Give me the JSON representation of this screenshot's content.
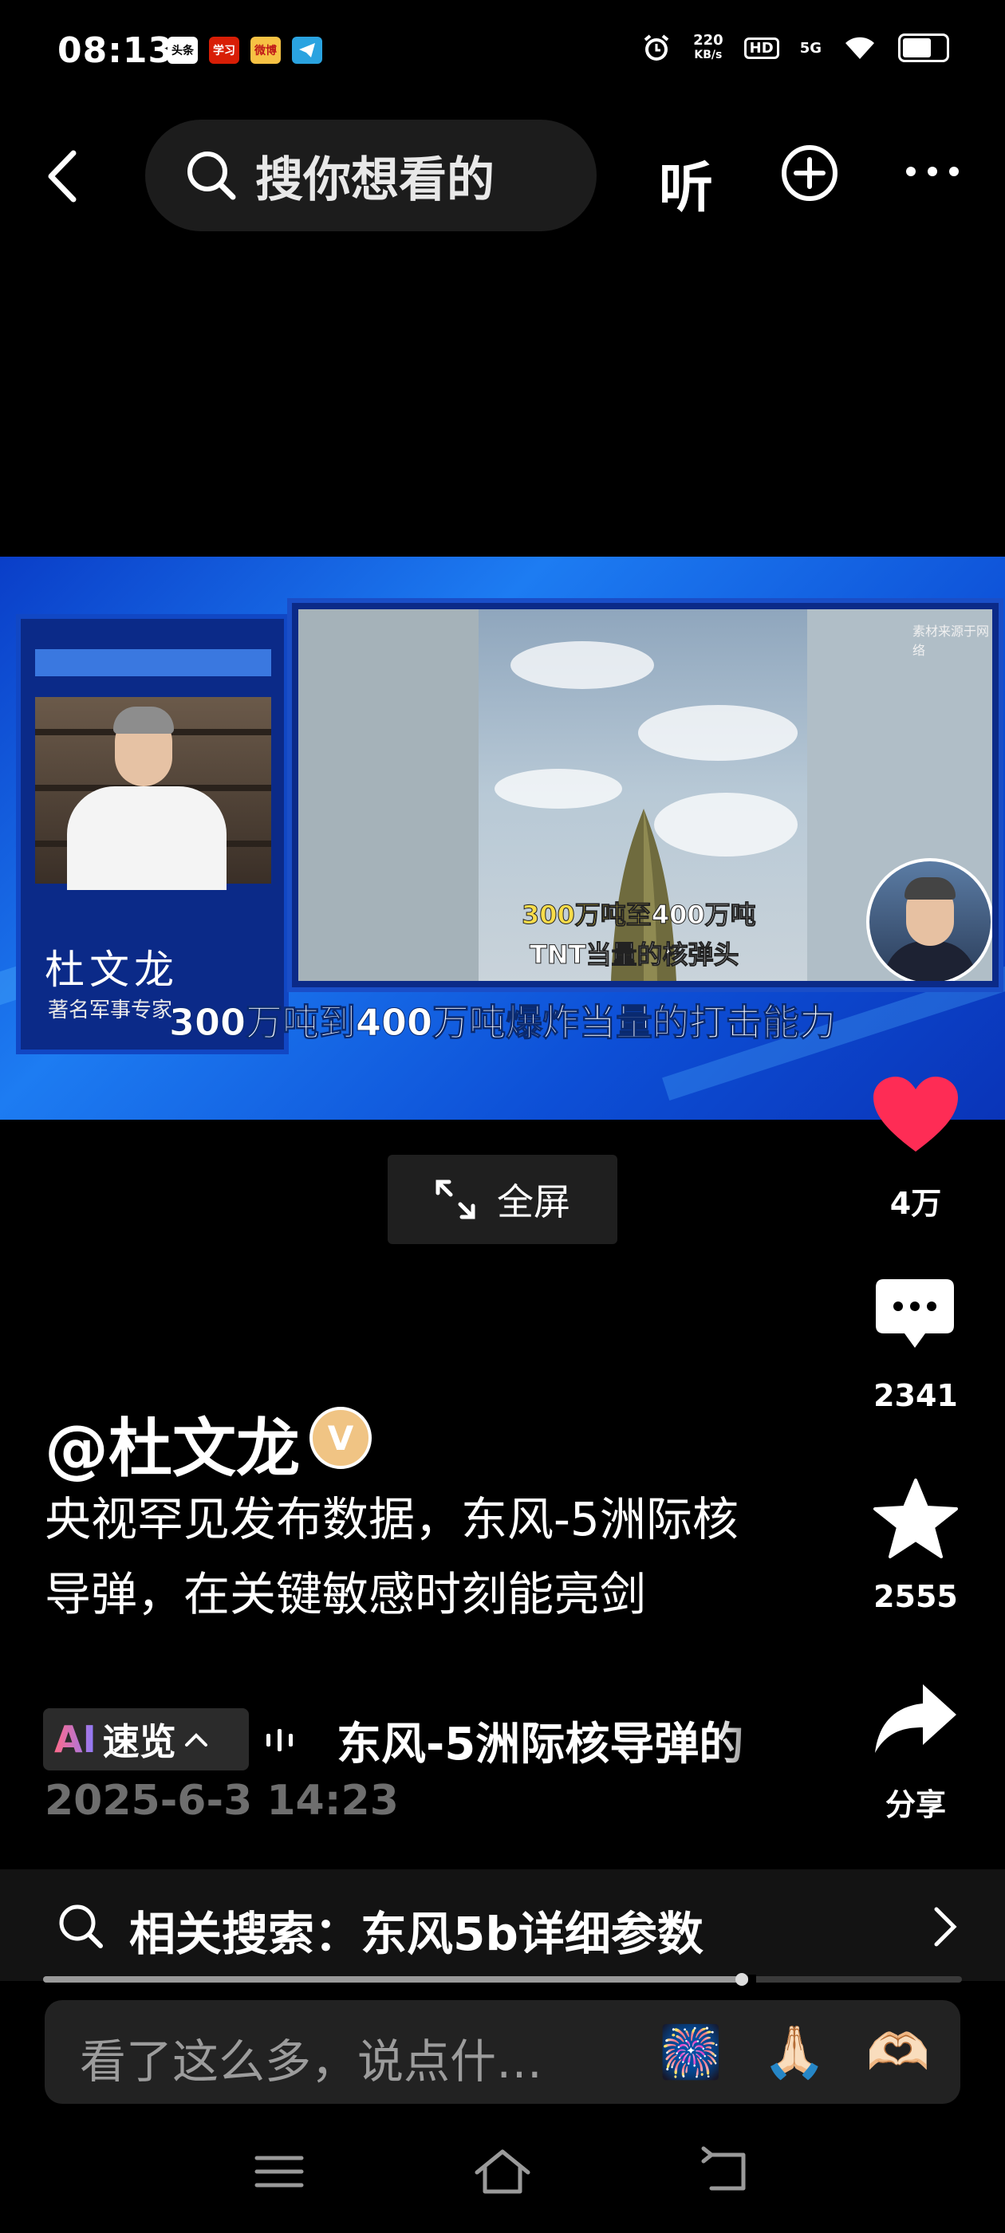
{
  "status_bar": {
    "time": "08:13",
    "apps": [
      {
        "icon": "toutiao-app-icon",
        "label": "头条",
        "color": "#ffffff"
      },
      {
        "icon": "xuexi-app-icon",
        "label": "学习",
        "color": "#d81e06"
      },
      {
        "icon": "weibo-app-icon",
        "label": "微博",
        "color": "#f7c244"
      },
      {
        "icon": "telegram-app-icon",
        "label": "",
        "color": "#2aa3e0"
      }
    ],
    "network_speed": "220",
    "network_unit": "KB/s",
    "hd_label": "HD",
    "signal_label": "5G"
  },
  "top_nav": {
    "search_placeholder": "搜你想看的",
    "listen_label": "听"
  },
  "video": {
    "expert_name": "杜文龙",
    "expert_title": "著名军事专家",
    "credit": "素材来源于网络",
    "caption_line1_a": "300万吨至",
    "caption_line1_b": "400万吨",
    "caption_line2": "TNT当量的核弹头",
    "subtitle": "300万吨到400万吨爆炸当量的打击能力"
  },
  "fullscreen_label": "全屏",
  "actions": {
    "likes": "4万",
    "comments": "2341",
    "favorites": "2555",
    "share": "分享",
    "like_color": "#fe2c55"
  },
  "post": {
    "author": "@杜文龙",
    "verified_badge": "V",
    "description": "央视罕见发布数据，东风-5洲际核导弹，在关键敏感时刻能亮剑",
    "ai_label": "AI",
    "ai_summary_label": "速览",
    "ai_summary_text": "东风-5洲际核导弹的",
    "date": "2025-6-3 14:23"
  },
  "related_search": {
    "label": "相关搜索：东风5b详细参数"
  },
  "playback": {
    "progress": 0.76
  },
  "comment_input": {
    "placeholder": "看了这么多，说点什…",
    "emojis": [
      "🎆",
      "🙏🏻",
      "🫶🏻"
    ]
  }
}
